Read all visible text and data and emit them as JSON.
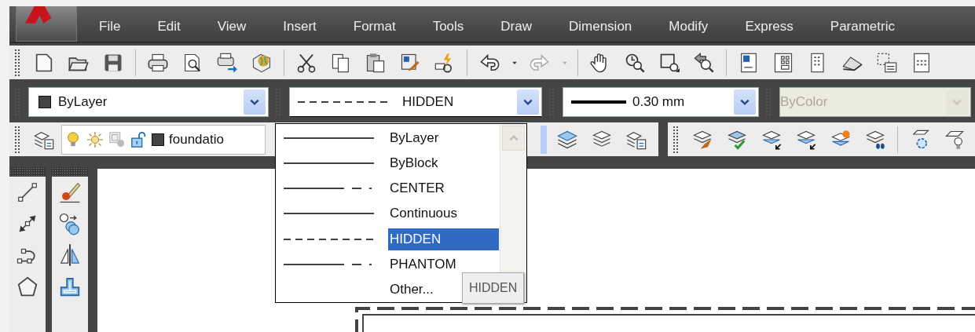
{
  "menu": [
    "File",
    "Edit",
    "View",
    "Insert",
    "Format",
    "Tools",
    "Draw",
    "Dimension",
    "Modify",
    "Express",
    "Parametric"
  ],
  "properties": {
    "color": {
      "value": "ByLayer"
    },
    "linetype": {
      "value": "HIDDEN",
      "expanded": true
    },
    "lineweight": {
      "value": "0.30 mm"
    },
    "plot_style": {
      "value": "ByColor",
      "disabled": true
    }
  },
  "layer": {
    "name": "foundatio",
    "on": true,
    "frozen": false,
    "locked": false
  },
  "linetype_list": [
    {
      "label": "ByLayer",
      "kind": "solid",
      "selected": false
    },
    {
      "label": "ByBlock",
      "kind": "solid",
      "selected": false
    },
    {
      "label": "CENTER",
      "kind": "center",
      "selected": false
    },
    {
      "label": "Continuous",
      "kind": "solid",
      "selected": false
    },
    {
      "label": "HIDDEN",
      "kind": "dashed",
      "selected": true
    },
    {
      "label": "PHANTOM",
      "kind": "phantom",
      "selected": false
    },
    {
      "label": "Other...",
      "kind": "other",
      "selected": false
    }
  ],
  "tooltip": "HIDDEN"
}
